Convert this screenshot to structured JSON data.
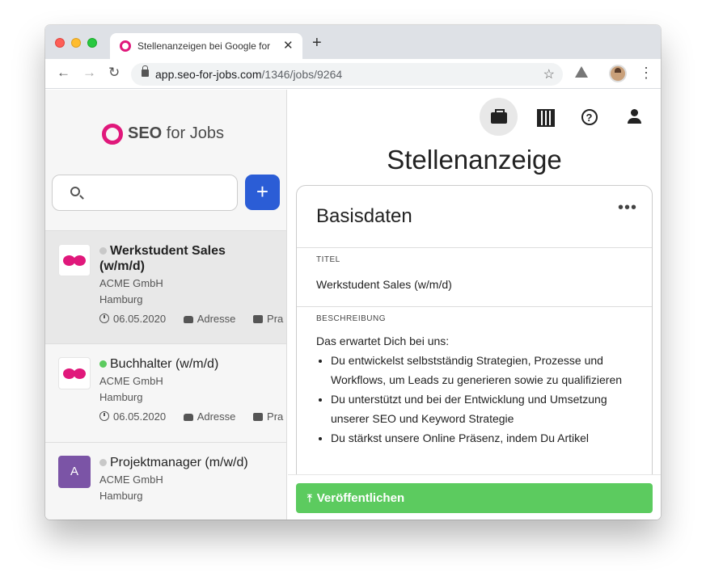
{
  "browser": {
    "tab_title": "Stellenanzeigen bei Google for",
    "url_domain": "app.seo-for-jobs.com",
    "url_path": "/1346/jobs/9264"
  },
  "sidebar": {
    "logo_bold": "SEO",
    "logo_rest": " for Jobs",
    "search_placeholder": "",
    "add_label": "+",
    "jobs": [
      {
        "title_line1": "Werkstudent Sales",
        "title_line2": "(w/m/d)",
        "company": "ACME GmbH",
        "city": "Hamburg",
        "date": "06.05.2020",
        "address": "Adresse",
        "type": "Pra",
        "status_color": "#c8c8c8"
      },
      {
        "title": "Buchhalter (w/m/d)",
        "company": "ACME GmbH",
        "city": "Hamburg",
        "date": "06.05.2020",
        "address": "Adresse",
        "type": "Pra",
        "status_color": "#5ccb5f"
      },
      {
        "title": "Projektmanager (m/w/d)",
        "company": "ACME GmbH",
        "city": "Hamburg",
        "avatar_letter": "A",
        "status_color": "#c8c8c8"
      }
    ]
  },
  "main": {
    "page_title": "Stellenanzeige",
    "card_title": "Basisdaten",
    "more_label": "•••",
    "title_label": "TITEL",
    "title_value": "Werkstudent Sales (w/m/d)",
    "desc_label": "BESCHREIBUNG",
    "desc_intro": "Das erwartet Dich bei uns:",
    "desc_items": [
      "Du entwickelst selbstständig Strategien, Prozesse und Workflows, um Leads zu generieren sowie zu qualifizieren",
      "Du unterstützt und bei der Entwicklung und Umsetzung unserer SEO und Keyword Strategie",
      "Du stärkst unsere Online Präsenz, indem Du Artikel"
    ],
    "publish_label": "Veröffentlichen"
  },
  "colors": {
    "brand": "#e0187b",
    "primary_button": "#2b5dd6",
    "publish_button": "#5ccb5f"
  }
}
